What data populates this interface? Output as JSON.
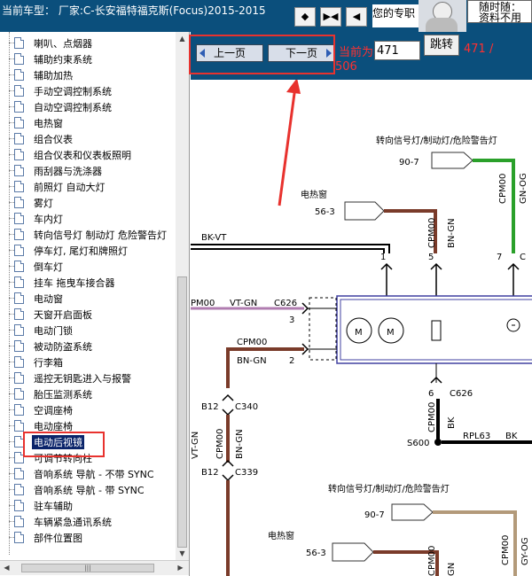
{
  "header": {
    "car_title": "当前车型： 厂家:C-长安福特福克斯(Focus)2015-2015",
    "nav_buttons": [
      "◆",
      "▶◀",
      "◀"
    ],
    "welcome": "您的专职",
    "ad_line1": "随时随：",
    "ad_line2": "资料不用"
  },
  "sidebar": {
    "items": [
      {
        "label": "喇叭、点烟器"
      },
      {
        "label": "辅助约束系统"
      },
      {
        "label": "辅助加热"
      },
      {
        "label": "手动空调控制系统"
      },
      {
        "label": "自动空调控制系统"
      },
      {
        "label": "电热窗"
      },
      {
        "label": "组合仪表"
      },
      {
        "label": "组合仪表和仪表板照明"
      },
      {
        "label": "雨刮器与洗涤器"
      },
      {
        "label": "前照灯 自动大灯"
      },
      {
        "label": "雾灯"
      },
      {
        "label": "车内灯"
      },
      {
        "label": "转向信号灯 制动灯 危险警告灯"
      },
      {
        "label": "停车灯, 尾灯和牌照灯"
      },
      {
        "label": "倒车灯"
      },
      {
        "label": "挂车 拖曳车接合器"
      },
      {
        "label": "电动窗"
      },
      {
        "label": "天窗开启面板"
      },
      {
        "label": "电动门锁"
      },
      {
        "label": "被动防盗系统"
      },
      {
        "label": "行李箱"
      },
      {
        "label": "遥控无钥匙进入与报警"
      },
      {
        "label": "胎压监测系统"
      },
      {
        "label": "空调座椅"
      },
      {
        "label": "电动座椅"
      },
      {
        "label": "电动后视镜"
      },
      {
        "label": "可调节转向柱"
      },
      {
        "label": "音响系统 导航 - 不带 SYNC"
      },
      {
        "label": "音响系统 导航 - 带 SYNC"
      },
      {
        "label": "驻车辅助"
      },
      {
        "label": "车辆紧急通讯系统"
      },
      {
        "label": "部件位置图"
      }
    ],
    "selected_index": 25
  },
  "nav": {
    "prev_label": "上一页",
    "next_label": "下一页",
    "current_label": "当前为",
    "page_value": "471",
    "jump_label": "跳转",
    "page_count_a": "471 /",
    "page_count_b": "506"
  },
  "diagram": {
    "texts": {
      "turn_signal_top": "转向信号灯/制动灯/危险警告灯",
      "conn_90_7": "90-7",
      "heated_window": "电热窗",
      "conn_56_3": "56-3",
      "wire_cpm00_1": "CPM00",
      "wire_gn_og": "GN-OG",
      "wire_cpm00_2": "CPM00",
      "wire_bn_gn": "BN-GN",
      "wire_bk_vt": "BK-VT",
      "pin_1": "1",
      "pin_5": "5",
      "pin_7": "7",
      "wire_pm00": "PM00",
      "wire_vt_gn": "VT-GN",
      "conn_c626": "C626",
      "pin_3": "3",
      "wire_cpm00_3": "CPM00",
      "wire_bn_gn_2": "BN-GN",
      "pin_2": "2",
      "motor_m1": "M",
      "motor_m2": "M",
      "pin_6": "6",
      "conn_c626_b": "C626",
      "wire_cpm00_4": "CPM00",
      "wire_bk": "BK",
      "ground_s600": "S600",
      "wire_rpl63": "RPL63",
      "wire_bk_2": "BK",
      "conn_b12_1": "B12",
      "conn_c340": "C340",
      "wire_vt_gn_2": "VT-GN",
      "wire_cpm00_5": "CPM00",
      "wire_bn_gn_3": "BN-GN",
      "conn_b12_2": "B12",
      "conn_c339": "C339",
      "turn_signal_bottom": "转向信号灯/制动灯/危险警告灯",
      "conn_90_7_b": "90-7",
      "heated_window_b": "电热窗",
      "conn_56_3_b": "56-3",
      "wire_cpm00_6": "CPM00",
      "wire_gy_og": "GY-OG",
      "wire_cpm00_7": "CPM00",
      "wire_gn_b": "GN"
    }
  },
  "colors": {
    "header_bg": "#0b4f7c",
    "highlight": "#e8322e",
    "wire_brown": "#7a3b2a",
    "wire_green": "#2aa02a",
    "wire_tan": "#b39a7a"
  }
}
